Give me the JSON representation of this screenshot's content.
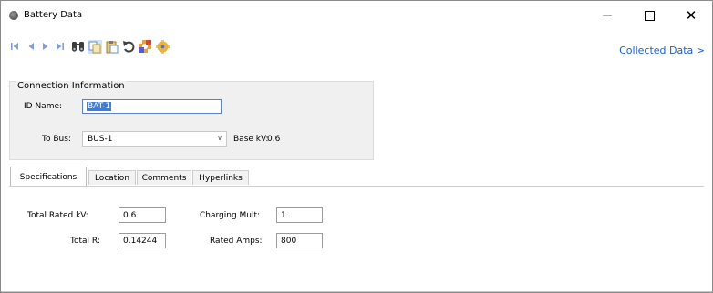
{
  "window": {
    "title": "Battery Data",
    "icon": "app-icon",
    "controls": {
      "minimize": "minimize",
      "maximize": "maximize",
      "close": "✕"
    }
  },
  "toolbar": {
    "icons": [
      "first-record-icon",
      "previous-record-icon",
      "next-record-icon",
      "last-record-icon",
      "find-icon",
      "copy-icon",
      "paste-icon",
      "undo-icon",
      "settings-icon",
      "settings-alt-icon"
    ],
    "link_label": "Collected Data >"
  },
  "connection": {
    "legend": "Connection Information",
    "id_label": "ID Name:",
    "id_value": "BAT-1",
    "bus_label": "To Bus:",
    "bus_value": "BUS-1",
    "base_kv_label": "Base kV:",
    "base_kv_value": "0.6"
  },
  "tabs": [
    {
      "label": "Specifications",
      "active": true
    },
    {
      "label": "Location",
      "active": false
    },
    {
      "label": "Comments",
      "active": false
    },
    {
      "label": "Hyperlinks",
      "active": false
    }
  ],
  "specs": {
    "total_rated_kv_label": "Total Rated kV:",
    "total_rated_kv_value": "0.6",
    "charging_mult_label": "Charging Mult:",
    "charging_mult_value": "1",
    "total_r_label": "Total R:",
    "total_r_value": "0.14244",
    "rated_amps_label": "Rated Amps:",
    "rated_amps_value": "800"
  },
  "colors": {
    "link": "#1a5fd0",
    "selection": "#3b7ee0",
    "nav_arrows": "#6d8fcc"
  }
}
